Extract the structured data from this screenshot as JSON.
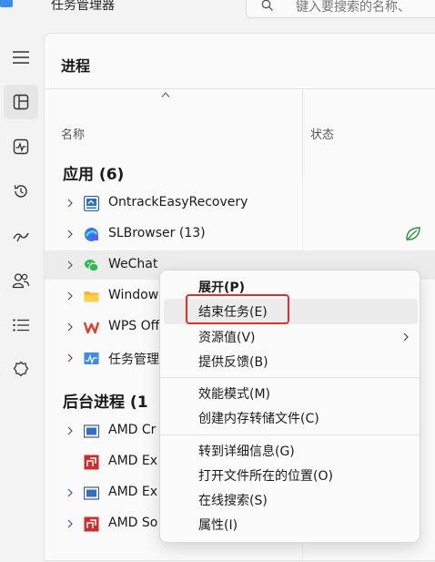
{
  "titlebar": {
    "app_title": "任务管理器",
    "search_placeholder": "键入要搜索的名称、"
  },
  "nav": {
    "items": [
      {
        "icon": "hamburger-menu-icon"
      },
      {
        "icon": "processes-icon",
        "active": true
      },
      {
        "icon": "performance-icon"
      },
      {
        "icon": "app-history-icon"
      },
      {
        "icon": "startup-apps-icon"
      },
      {
        "icon": "users-icon"
      },
      {
        "icon": "details-icon"
      },
      {
        "icon": "services-icon"
      }
    ]
  },
  "panel": {
    "title": "进程",
    "columns": {
      "name": "名称",
      "status": "状态"
    },
    "groups": {
      "apps": {
        "title": "应用 (6)",
        "rows": [
          {
            "name": "OntrackEasyRecovery",
            "icon": "ontrack-app-icon"
          },
          {
            "name": "SLBrowser (13)",
            "icon": "slbrowser-app-icon",
            "status_icon": "efficiency-leaf-icon"
          },
          {
            "name": "WeChat",
            "icon": "wechat-app-icon",
            "hover": true
          },
          {
            "name": "Window",
            "icon": "folder-app-icon"
          },
          {
            "name": "WPS Off",
            "icon": "wps-app-icon"
          },
          {
            "name": "任务管理",
            "icon": "task-manager-app-icon"
          }
        ]
      },
      "background": {
        "title": "后台进程 (1",
        "rows": [
          {
            "name": "AMD Cr",
            "icon": "amd-window-icon",
            "expandable": true
          },
          {
            "name": "AMD Ex",
            "icon": "amd-red-icon",
            "expandable": false
          },
          {
            "name": "AMD Ex",
            "icon": "amd-window-icon",
            "expandable": true
          },
          {
            "name": "AMD So",
            "icon": "amd-red-icon",
            "expandable": true
          }
        ]
      }
    }
  },
  "context_menu": {
    "items": [
      {
        "label": "展开(P)",
        "bold": true
      },
      {
        "label": "结束任务(E)",
        "highlighted": true
      },
      {
        "label": "资源值(V)",
        "submenu": true
      },
      {
        "label": "提供反馈(B)"
      },
      {
        "label": "效能模式(M)"
      },
      {
        "label": "创建内存转储文件(C)"
      },
      {
        "label": "转到详细信息(G)"
      },
      {
        "label": "打开文件所在的位置(O)"
      },
      {
        "label": "在线搜索(S)"
      },
      {
        "label": "属性(I)"
      }
    ]
  },
  "colors": {
    "highlight_box": "#e0302b",
    "accent": "#1f6fd6"
  }
}
